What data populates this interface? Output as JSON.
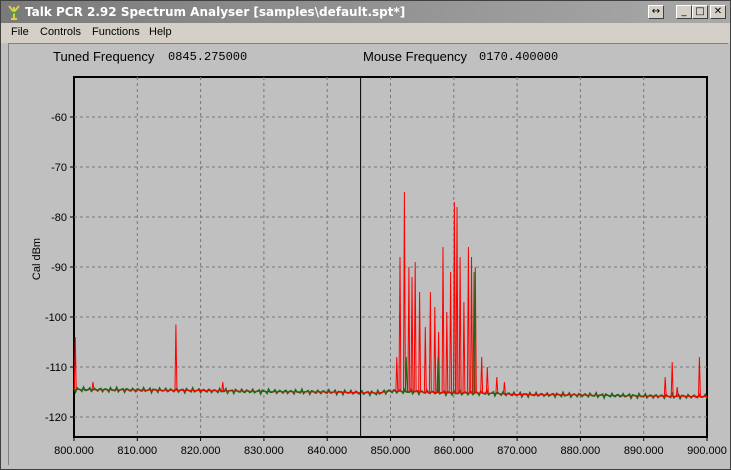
{
  "window": {
    "title": "Talk PCR 2.92 Spectrum Analyser [samples\\default.spt*]",
    "buttons": {
      "restore": "↔",
      "minimize": "_",
      "maximize": "□",
      "close": "✕"
    }
  },
  "menu": [
    "File",
    "Controls",
    "Functions",
    "Help"
  ],
  "readouts": {
    "tuned_label": "Tuned Frequency",
    "tuned_value": "0845.275000",
    "mouse_label": "Mouse Frequency",
    "mouse_value": "0170.400000"
  },
  "colors": {
    "trace_red": "#ff0000",
    "trace_green": "#1a6a1a",
    "grid": "#777777"
  },
  "chart_data": {
    "type": "line",
    "ylabel": "Cal dBm",
    "xlabel": "",
    "xlim": [
      800,
      900
    ],
    "ylim": [
      -124,
      -52
    ],
    "x_ticks": [
      800,
      810,
      820,
      830,
      840,
      850,
      860,
      870,
      880,
      890,
      900
    ],
    "x_tick_labels": [
      "800.000",
      "810.000",
      "820.000",
      "830.000",
      "840.000",
      "850.000",
      "860.000",
      "870.000",
      "880.000",
      "890.000",
      "900.000"
    ],
    "y_ticks": [
      -60,
      -70,
      -80,
      -90,
      -100,
      -110,
      -120
    ],
    "y_tick_labels": [
      "-60",
      "-70",
      "-80",
      "-90",
      "-100",
      "-110",
      "-120"
    ],
    "grid": true,
    "cursor_x": 845.275,
    "baseline": [
      [
        800,
        -114.5
      ],
      [
        810,
        -114.6
      ],
      [
        820,
        -114.7
      ],
      [
        830,
        -114.9
      ],
      [
        840,
        -115.0
      ],
      [
        848,
        -115.2
      ],
      [
        850,
        -114.8
      ],
      [
        860,
        -115.2
      ],
      [
        865,
        -115.2
      ],
      [
        870,
        -115.5
      ],
      [
        880,
        -115.6
      ],
      [
        890,
        -115.8
      ],
      [
        900,
        -115.9
      ]
    ],
    "series": [
      {
        "color": "red",
        "peaks": [
          {
            "x": 800.2,
            "y": -104
          },
          {
            "x": 803.0,
            "y": -113
          },
          {
            "x": 816.1,
            "y": -101.5
          },
          {
            "x": 823.5,
            "y": -113
          },
          {
            "x": 851.0,
            "y": -108
          },
          {
            "x": 851.5,
            "y": -88
          },
          {
            "x": 852.2,
            "y": -75
          },
          {
            "x": 852.9,
            "y": -90
          },
          {
            "x": 853.4,
            "y": -92
          },
          {
            "x": 853.9,
            "y": -89
          },
          {
            "x": 854.6,
            "y": -95
          },
          {
            "x": 855.5,
            "y": -102
          },
          {
            "x": 856.3,
            "y": -95
          },
          {
            "x": 857.0,
            "y": -98
          },
          {
            "x": 857.6,
            "y": -103
          },
          {
            "x": 858.3,
            "y": -86
          },
          {
            "x": 858.9,
            "y": -99
          },
          {
            "x": 859.5,
            "y": -91
          },
          {
            "x": 860.1,
            "y": -77
          },
          {
            "x": 860.5,
            "y": -78
          },
          {
            "x": 861.0,
            "y": -88
          },
          {
            "x": 861.6,
            "y": -97
          },
          {
            "x": 862.3,
            "y": -86
          },
          {
            "x": 862.8,
            "y": -88
          },
          {
            "x": 863.4,
            "y": -90
          },
          {
            "x": 864.4,
            "y": -108
          },
          {
            "x": 865.3,
            "y": -110
          },
          {
            "x": 866.8,
            "y": -112
          },
          {
            "x": 868.0,
            "y": -113
          },
          {
            "x": 893.4,
            "y": -112
          },
          {
            "x": 894.5,
            "y": -109
          },
          {
            "x": 895.3,
            "y": -114
          },
          {
            "x": 898.8,
            "y": -108
          }
        ]
      },
      {
        "color": "green",
        "peaks": [
          {
            "x": 863.2,
            "y": -91
          },
          {
            "x": 852.5,
            "y": -108
          },
          {
            "x": 857.5,
            "y": -108
          }
        ]
      }
    ]
  }
}
